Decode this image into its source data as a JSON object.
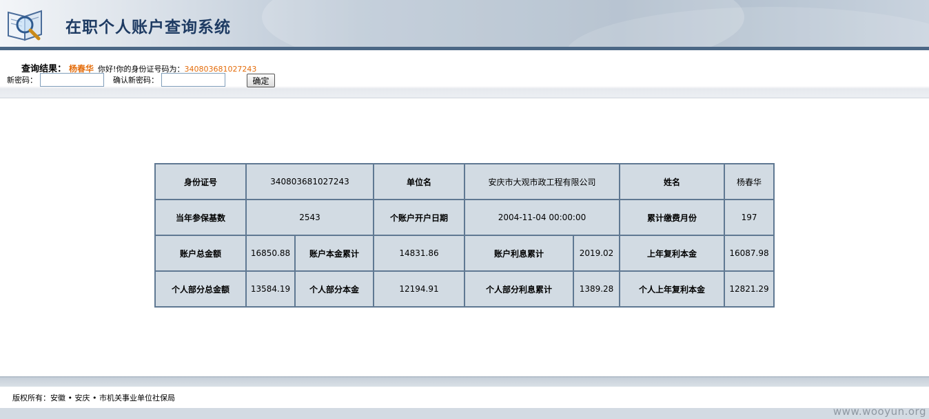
{
  "header": {
    "title": "在职个人账户查询系统",
    "logo_icon": "magnifier-book-icon"
  },
  "query": {
    "result_label": "查询结果：",
    "name": "杨春华",
    "greeting": "你好!你的身份证号码为：",
    "id_number": "340803681027243",
    "new_password_label": "新密码：",
    "new_password_value": "",
    "confirm_password_label": "确认新密码：",
    "confirm_password_value": "",
    "confirm_button": "确定"
  },
  "table": {
    "rows": [
      [
        "身份证号",
        "340803681027243",
        "单位名",
        "安庆市大观市政工程有限公司",
        "姓名",
        "杨春华"
      ],
      [
        "当年参保基数",
        "2543",
        "个账户开户日期",
        "2004-11-04 00:00:00",
        "累计缴费月份",
        "197"
      ],
      [
        "账户总金额",
        "16850.88",
        "账户本金累计",
        "14831.86",
        "账户利息累计",
        "2019.02",
        "上年复利本金",
        "16087.98"
      ],
      [
        "个人部分总金额",
        "13584.19",
        "个人部分本金",
        "12194.91",
        "个人部分利息累计",
        "1389.28",
        "个人上年复利本金",
        "12821.29"
      ]
    ]
  },
  "footer": {
    "copyright": "版权所有：安徽 • 安庆 • 市机关事业单位社保局"
  },
  "watermark": "www.wooyun.org",
  "colors": {
    "title": "#1e3b63",
    "highlight": "#e46c0a",
    "table_bg": "#d2dbe3",
    "table_border": "#5f7892"
  }
}
